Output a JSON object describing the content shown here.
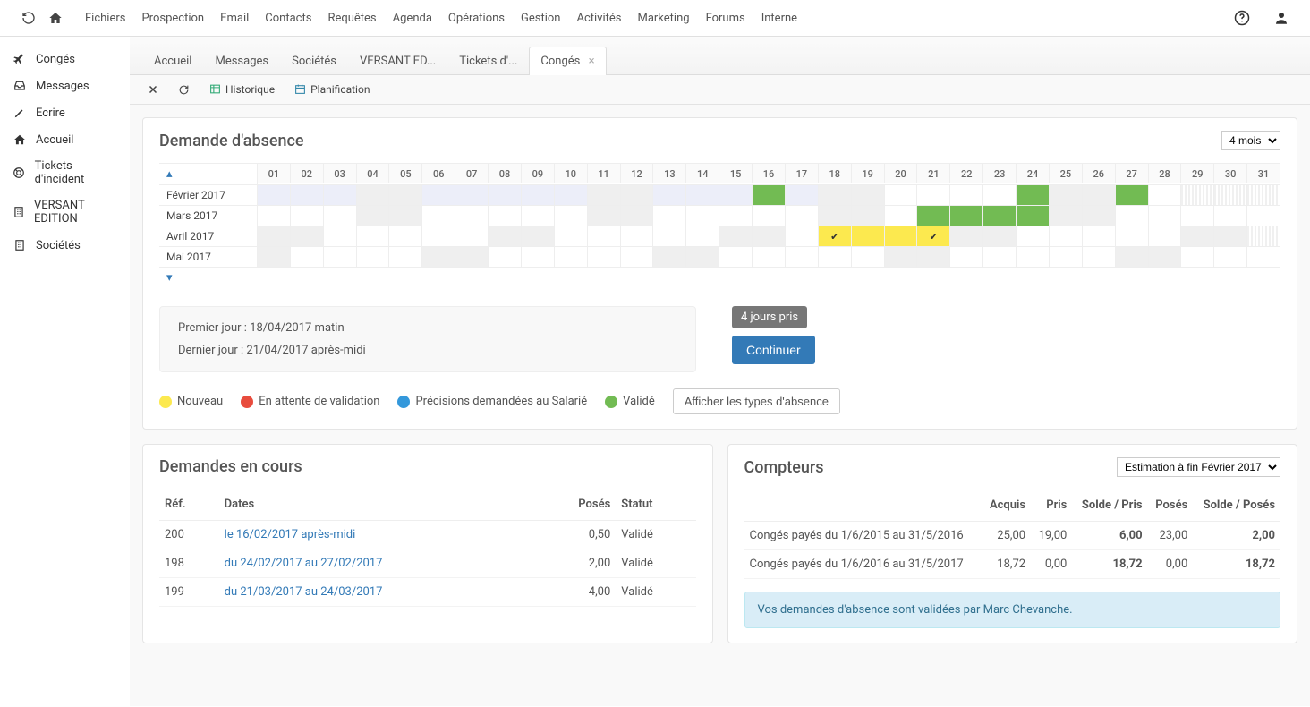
{
  "topMenu": [
    "Fichiers",
    "Prospection",
    "Email",
    "Contacts",
    "Requêtes",
    "Agenda",
    "Opérations",
    "Gestion",
    "Activités",
    "Marketing",
    "Forums",
    "Interne"
  ],
  "sidebar": [
    {
      "id": "conges",
      "label": "Congés"
    },
    {
      "id": "messages",
      "label": "Messages"
    },
    {
      "id": "ecrire",
      "label": "Ecrire"
    },
    {
      "id": "accueil",
      "label": "Accueil"
    },
    {
      "id": "tickets",
      "label": "Tickets d'incident"
    },
    {
      "id": "versant",
      "label": "VERSANT EDITION"
    },
    {
      "id": "societes",
      "label": "Sociétés"
    }
  ],
  "tabs": [
    {
      "label": "Accueil",
      "active": false
    },
    {
      "label": "Messages",
      "active": false
    },
    {
      "label": "Sociétés",
      "active": false
    },
    {
      "label": "VERSANT ED...",
      "active": false
    },
    {
      "label": "Tickets d'...",
      "active": false
    },
    {
      "label": "Congés",
      "active": true
    }
  ],
  "toolbar": {
    "historique": "Historique",
    "planification": "Planification"
  },
  "panel": {
    "title": "Demande d'absence",
    "rangeSelect": "4 mois",
    "months": [
      "Février 2017",
      "Mars 2017",
      "Avril 2017",
      "Mai 2017"
    ],
    "days": [
      "01",
      "02",
      "03",
      "04",
      "05",
      "06",
      "07",
      "08",
      "09",
      "10",
      "11",
      "12",
      "13",
      "14",
      "15",
      "16",
      "17",
      "18",
      "19",
      "20",
      "21",
      "22",
      "23",
      "24",
      "25",
      "26",
      "27",
      "28",
      "29",
      "30",
      "31"
    ],
    "first": "Premier jour : 18/04/2017 matin",
    "last": "Dernier jour : 21/04/2017 après-midi",
    "badge": "4 jours pris",
    "continue": "Continuer",
    "legend": {
      "nouveau": "Nouveau",
      "attente": "En attente de validation",
      "precis": "Précisions demandées au Salarié",
      "valide": "Validé"
    },
    "showTypes": "Afficher les types d'absence"
  },
  "pending": {
    "title": "Demandes en cours",
    "headers": {
      "ref": "Réf.",
      "dates": "Dates",
      "poses": "Posés",
      "statut": "Statut"
    },
    "rows": [
      {
        "ref": "200",
        "dates": "le 16/02/2017 après-midi",
        "poses": "0,50",
        "statut": "Validé"
      },
      {
        "ref": "198",
        "dates": "du 24/02/2017 au 27/02/2017",
        "poses": "2,00",
        "statut": "Validé"
      },
      {
        "ref": "199",
        "dates": "du 21/03/2017 au 24/03/2017",
        "poses": "4,00",
        "statut": "Validé"
      }
    ]
  },
  "counters": {
    "title": "Compteurs",
    "select": "Estimation à fin Février 2017",
    "headers": {
      "acquis": "Acquis",
      "pris": "Pris",
      "soldePris": "Solde / Pris",
      "poses": "Posés",
      "soldePoses": "Solde / Posés"
    },
    "rows": [
      {
        "label": "Congés payés du 1/6/2015 au 31/5/2016",
        "acquis": "25,00",
        "pris": "19,00",
        "soldePris": "6,00",
        "poses": "23,00",
        "soldePoses": "2,00"
      },
      {
        "label": "Congés payés du 1/6/2016 au 31/5/2017",
        "acquis": "18,72",
        "pris": "0,00",
        "soldePris": "18,72",
        "poses": "0,00",
        "soldePoses": "18,72"
      }
    ],
    "info": "Vos demandes d'absence sont validées par Marc Chevanche."
  }
}
